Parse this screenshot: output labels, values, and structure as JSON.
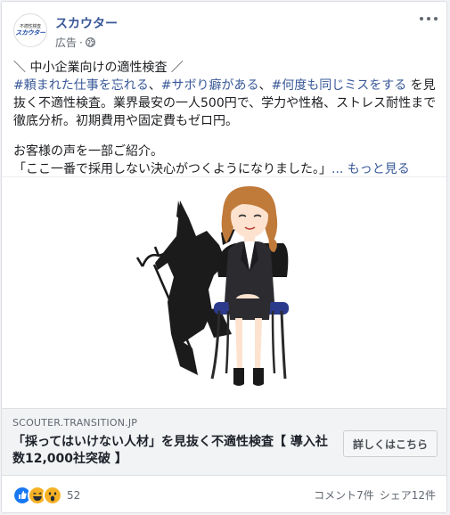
{
  "post": {
    "page_name": "スカウター",
    "avatar_line1": "不適性検査",
    "avatar_line2": "スカウター",
    "sponsored_label": "広告",
    "separator": "·",
    "line1": "＼ 中小企業向けの適性検査 ／",
    "tags": [
      "#頼まれた仕事を忘れる",
      "#サボり癖がある",
      "#何度も同じミスをする"
    ],
    "tag_sep": "、",
    "line2_tail": "を見抜く不適性検査。業界最安の一人500円で、学力や性格、ストレス耐性まで徹底分析。初期費用や固定費もゼロ円。",
    "line3": "お客様の声を一部ご紹介。",
    "line4": "「ここ一番で採用しない決心がつくようになりました。」",
    "see_more": "... もっと見る"
  },
  "link_preview": {
    "domain": "SCOUTER.TRANSITION.JP",
    "title": "「採ってはいけない人材」を見抜く不適性検査【 導入社数12,000社突破 】",
    "cta_label": "詳しくはこちら"
  },
  "footer": {
    "reaction_icons": [
      "like-icon",
      "haha-icon",
      "wow-icon"
    ],
    "reaction_count": "52",
    "comments": "コメント7件",
    "shares": "シェア12件"
  },
  "colors": {
    "link_blue": "#385898",
    "like_blue": "#1877f2",
    "reaction_yellow": "#f7b125",
    "suit": "#2b2b30",
    "chair": "#2c3a8c",
    "hair": "#c07a3a"
  }
}
